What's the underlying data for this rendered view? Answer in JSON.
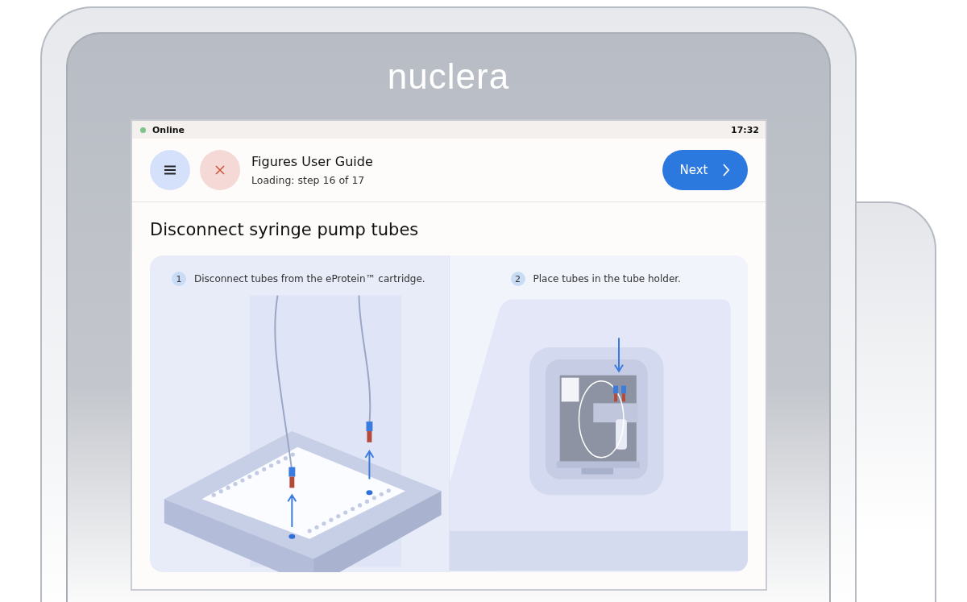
{
  "device": {
    "brand": "nuclera"
  },
  "status_bar": {
    "online": true,
    "status": "Online",
    "time": "17:32"
  },
  "header": {
    "title": "Figures User Guide",
    "subtitle": "Loading: step 16 of 17",
    "next_button": "Next"
  },
  "page_title": "Disconnect syringe pump tubes",
  "steps": [
    {
      "number": "1",
      "text": "Disconnect tubes from the eProtein™ cartridge.",
      "kind": "cartridge"
    },
    {
      "number": "2",
      "text": "Place tubes in the tube holder.",
      "kind": "holder"
    }
  ]
}
